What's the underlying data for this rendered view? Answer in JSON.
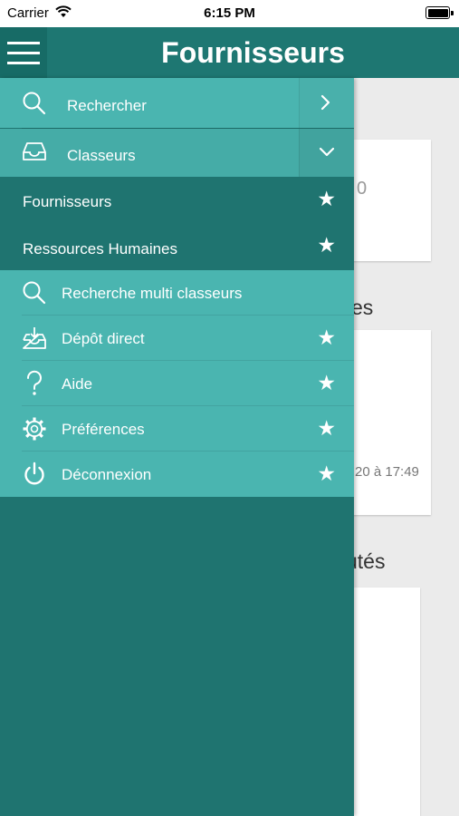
{
  "status_bar": {
    "carrier": "Carrier",
    "time": "6:15 PM"
  },
  "header": {
    "title": "Fournisseurs",
    "menu_icon": "hamburger-icon"
  },
  "drawer": {
    "search": {
      "label": "Rechercher",
      "icon": "search-icon"
    },
    "classeurs": {
      "label": "Classeurs",
      "icon": "inbox-tray-icon"
    },
    "classeur_items": [
      {
        "label": "Fournisseurs"
      },
      {
        "label": "Ressources Humaines"
      }
    ],
    "menu_items": [
      {
        "label": "Recherche multi classeurs",
        "icon": "search-icon",
        "starred": false
      },
      {
        "label": "Dépôt direct",
        "icon": "download-tray-icon",
        "starred": true
      },
      {
        "label": "Aide",
        "icon": "question-icon",
        "starred": true
      },
      {
        "label": "Préférences",
        "icon": "gear-icon",
        "starred": true
      },
      {
        "label": "Déconnexion",
        "icon": "power-icon",
        "starred": true
      }
    ]
  },
  "background": {
    "card1_text": "0",
    "section2_title": "es",
    "card2_text": "20 à 17:49",
    "section3_title": "utés"
  },
  "colors": {
    "nav": "#1e7772",
    "drawer_light": "#4ab5b0",
    "drawer_header": "#45aca7",
    "drawer_dark": "#1f7470"
  }
}
